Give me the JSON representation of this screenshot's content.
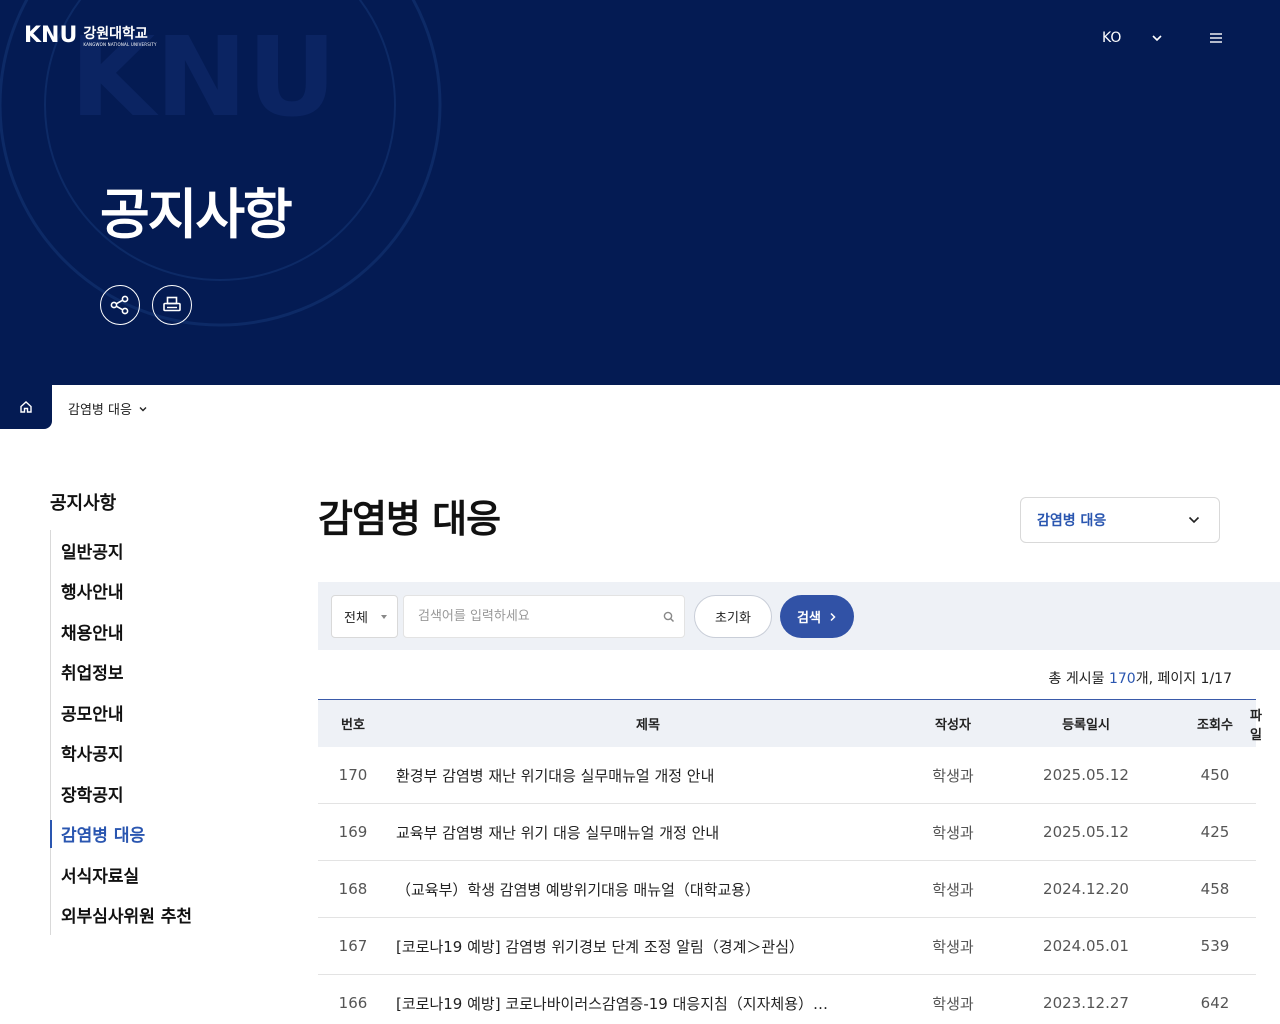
{
  "header": {
    "logo_mark": "KNU",
    "logo_kr": "강원대학교",
    "logo_en": "KANGWON NATIONAL UNIVERSITY",
    "lang": "KO",
    "page_heading": "공지사항"
  },
  "breadcrumb": {
    "current": "감염병 대응"
  },
  "sidebar": {
    "title": "공지사항",
    "items": [
      {
        "label": "일반공지"
      },
      {
        "label": "행사안내"
      },
      {
        "label": "채용안내"
      },
      {
        "label": "취업정보"
      },
      {
        "label": "공모안내"
      },
      {
        "label": "학사공지"
      },
      {
        "label": "장학공지"
      },
      {
        "label": "감염병 대응"
      },
      {
        "label": "서식자료실"
      },
      {
        "label": "외부심사위원 추천"
      }
    ],
    "active_index": 7
  },
  "main": {
    "title": "감염병 대응",
    "category_select": "감염병 대응"
  },
  "search": {
    "scope": "전체",
    "placeholder": "검색어를 입력하세요",
    "reset_label": "초기화",
    "submit_label": "검색"
  },
  "summary": {
    "prefix": "총 게시물 ",
    "count": "170",
    "suffix": "개, 페이지 1/17"
  },
  "table": {
    "headers": {
      "num": "번호",
      "title": "제목",
      "writer": "작성자",
      "date": "등록일시",
      "views": "조회수",
      "file": "파일"
    },
    "rows": [
      {
        "num": "170",
        "title": "환경부 감염병 재난 위기대응 실무매뉴얼 개정 안내",
        "writer": "학생과",
        "date": "2025.05.12",
        "views": "450"
      },
      {
        "num": "169",
        "title": "교육부 감염병 재난 위기 대응 실무매뉴얼 개정 안내",
        "writer": "학생과",
        "date": "2025.05.12",
        "views": "425"
      },
      {
        "num": "168",
        "title": "（교육부）학생 감염병 예방위기대응 매뉴얼（대학교용）",
        "writer": "학생과",
        "date": "2024.12.20",
        "views": "458"
      },
      {
        "num": "167",
        "title": "[코로나19 예방] 감염병 위기경보 단계 조정 알림（경계＞관심）",
        "writer": "학생과",
        "date": "2024.05.01",
        "views": "539"
      },
      {
        "num": "166",
        "title": "[코로나19 예방] 코로나바이러스감염증-19 대응지침（지자체용）…",
        "writer": "학생과",
        "date": "2023.12.27",
        "views": "642"
      }
    ]
  },
  "colors": {
    "hero_bg": "#041b53",
    "accent": "#2a56b0",
    "search_btn": "#3152a6"
  }
}
